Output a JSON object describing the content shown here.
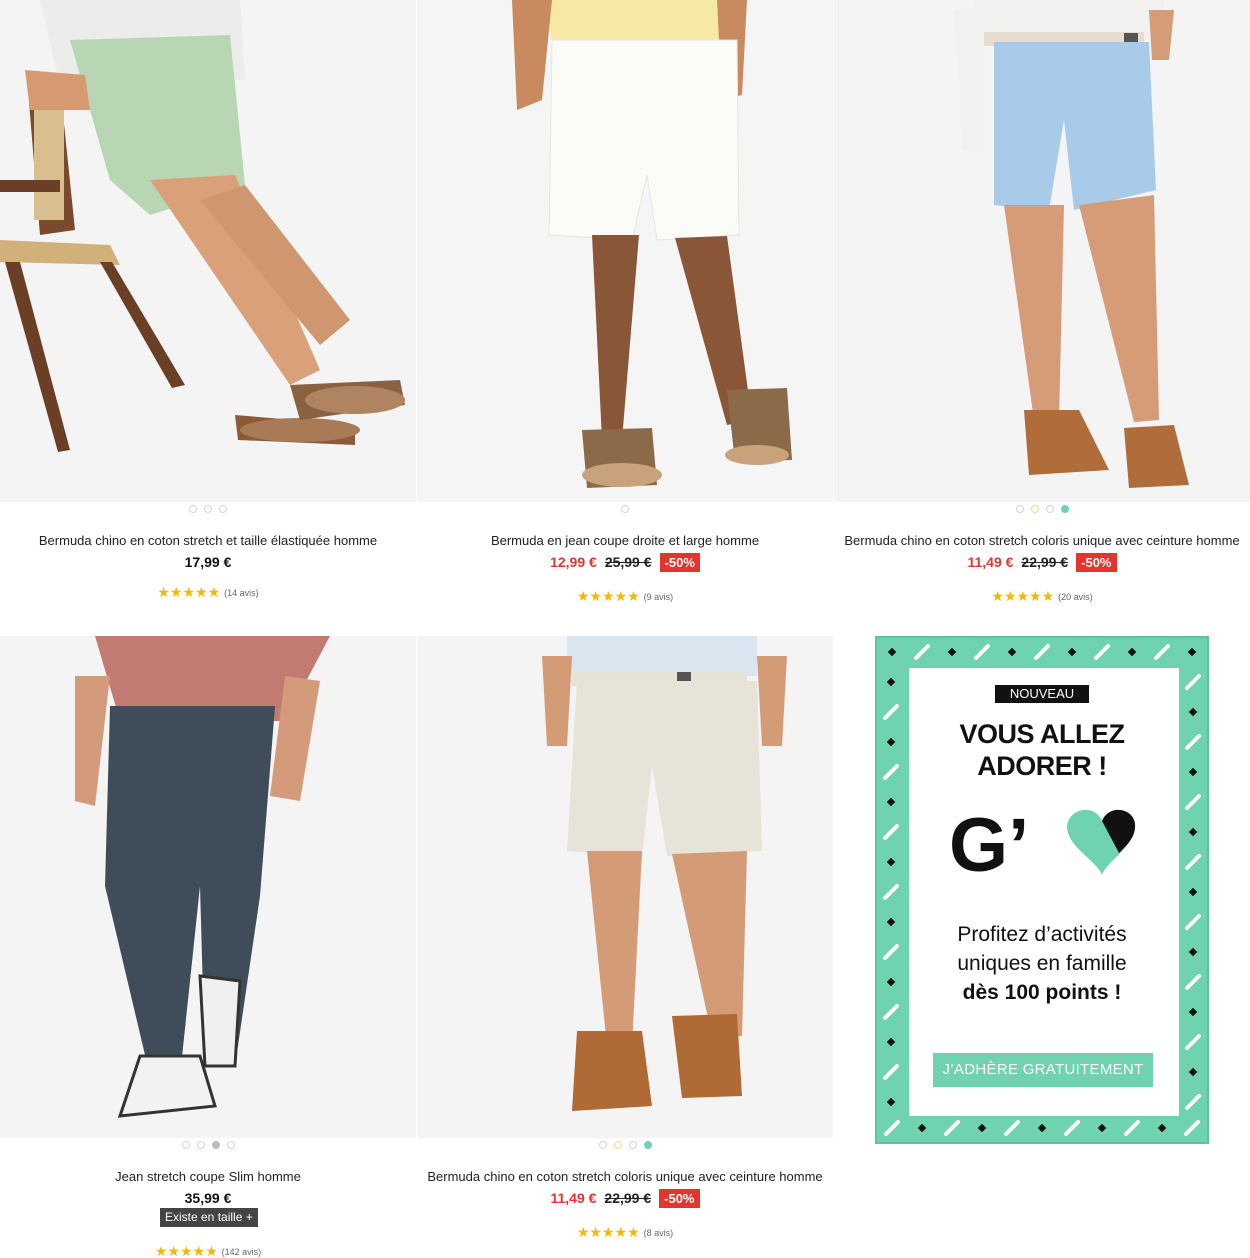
{
  "products": [
    {
      "title": "Bermuda chino en coton stretch et taille élastiquée homme",
      "price": "17,99 €",
      "rating_stars": "★★★★★",
      "reviews": "(14 avis)",
      "image": "man-in-green-bermuda-shorts-on-chair",
      "dots": 3
    },
    {
      "title": "Bermuda en jean coupe droite et large homme",
      "price": "12,99 €",
      "old_price": "25,99 €",
      "discount": "-50%",
      "rating_stars": "★★★★★",
      "reviews": "(9 avis)",
      "image": "man-in-white-denim-bermuda",
      "dots": 1
    },
    {
      "title": "Bermuda chino en coton stretch coloris unique avec ceinture homme",
      "price": "11,49 €",
      "old_price": "22,99 €",
      "discount": "-50%",
      "rating_stars": "★★★★★",
      "reviews": "(20 avis)",
      "image": "man-in-light-blue-chino-bermuda",
      "dots": 4
    },
    {
      "title": "Jean stretch coupe Slim homme",
      "price": "35,99 €",
      "sizes_label": "Existe en taille +",
      "rating_stars": "★★★★★",
      "reviews": "(142 avis)",
      "image": "man-in-dark-slim-jeans",
      "dots": 4
    },
    {
      "title": "Bermuda chino en coton stretch coloris unique avec ceinture homme",
      "price": "11,49 €",
      "old_price": "22,99 €",
      "discount": "-50%",
      "rating_stars": "★★★★★",
      "reviews": "(8 avis)",
      "image": "man-in-beige-chino-bermuda",
      "dots": 4
    }
  ],
  "promo": {
    "badge": "NOUVEAU",
    "headline_1": "VOUS ALLEZ",
    "headline_2": "ADORER !",
    "logo": "G’",
    "body_1": "Profitez d’activités",
    "body_2": "uniques en famille",
    "body_3": "dès 100 points !",
    "cta": "J’ADHÈRE GRATUITEMENT"
  },
  "colors": {
    "sale_red": "#e3342f",
    "star_yellow": "#f5b800",
    "promo_mint": "#6ed3ae"
  }
}
